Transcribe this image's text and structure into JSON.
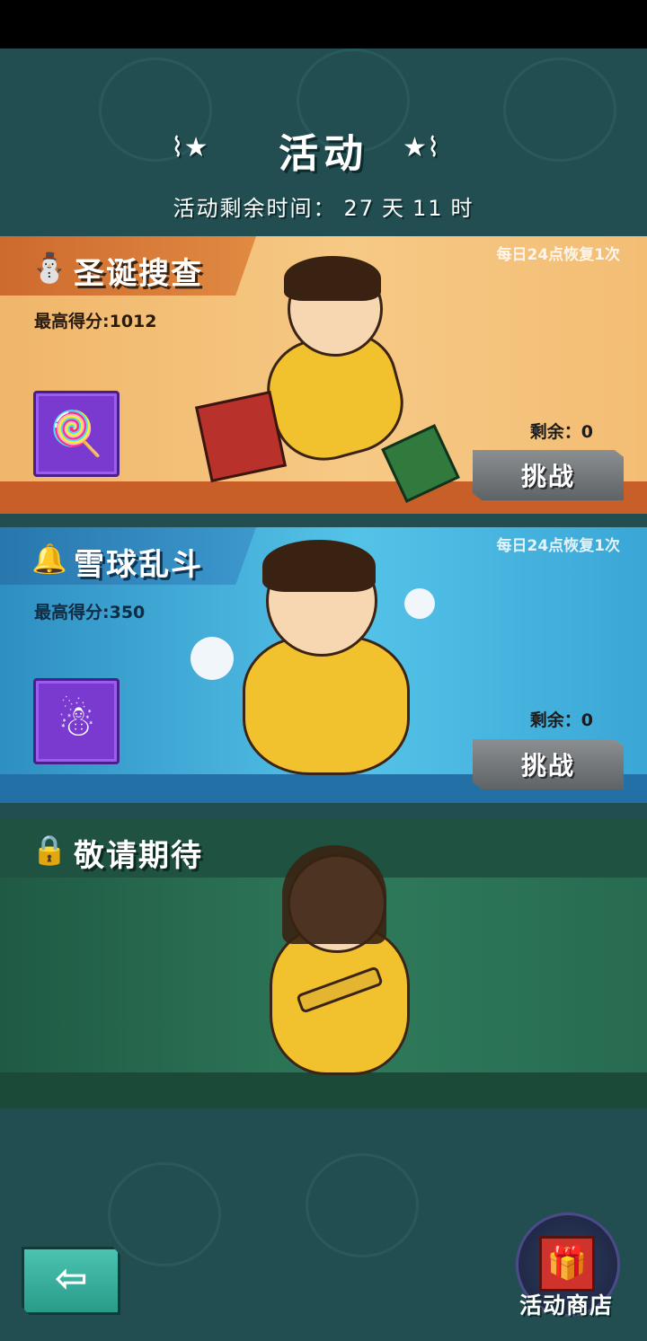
{
  "header": {
    "title": "活动",
    "left_deco": "⌇★",
    "right_deco": "★⌇",
    "remaining_label": "活动剩余时间：",
    "remaining_days": "27",
    "days_unit": "天",
    "remaining_hours": "11",
    "hours_unit": "时"
  },
  "events": [
    {
      "title": "圣诞搜查",
      "icon": "snowman-face-icon",
      "icon_glyph": "⛄",
      "refresh_note": "每日24点恢复1次",
      "best_score_label": "最高得分:1012",
      "reward_icon": "candy-cane-icon",
      "reward_glyph": "🍭",
      "remaining_label": "剩余：0",
      "button_label": "挑战"
    },
    {
      "title": "雪球乱斗",
      "icon": "bell-icon",
      "icon_glyph": "🔔",
      "refresh_note": "每日24点恢复1次",
      "best_score_label": "最高得分:350",
      "reward_icon": "snowman-cookie-icon",
      "reward_glyph": "☃",
      "remaining_label": "剩余：0",
      "button_label": "挑战"
    },
    {
      "title": "敬请期待",
      "icon": "lock-icon",
      "icon_glyph": "🔒"
    }
  ],
  "footer": {
    "back_glyph": "⇦",
    "shop_label": "活动商店",
    "shop_glyph": "🎁"
  },
  "colors": {
    "background": "#224e51",
    "xmas_card": "#f6c985",
    "snow_card": "#54c3e8",
    "locked_card": "#2f7a5b",
    "reward_slot": "#7a3ad0"
  }
}
